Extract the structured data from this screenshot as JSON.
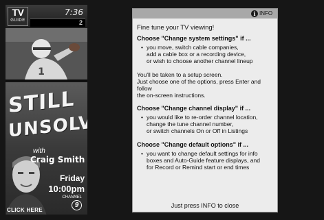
{
  "header": {
    "logo_top": "TV",
    "logo_bottom": "GUIDE",
    "clock": "7:36",
    "channel": "2"
  },
  "ad": {
    "title_line1": "STILL",
    "title_line2": "UNSOLVED",
    "with": "with",
    "host": "Craig Smith",
    "day": "Friday",
    "time": "10:00pm",
    "channel_word": "CHANNEL",
    "channel_num": "9",
    "cta": "CLICK HERE"
  },
  "info": {
    "header_icon": "i",
    "header_label": "INFO",
    "intro": "Fine tune your TV viewing!",
    "sections": [
      {
        "heading": "Choose \"Change system settings\" if ...",
        "bullet": "you move, switch cable companies,\nadd a cable box or a recording device,\nor wish to choose another channel lineup"
      },
      {
        "heading": "Choose \"Change channel display\" if ...",
        "bullet": "you would like to re-order channel location,\nchange the tune channel number,\nor switch channels On or Off in Listings"
      },
      {
        "heading": "Choose \"Change default options\" if ...",
        "bullet": "you want to change default settings for info\nboxes and Auto-Guide feature displays, and\nfor Record or Remind start or end times"
      }
    ],
    "setup_note": "You'll be taken to a setup screen.\nJust choose one of the options, press Enter and follow\nthe on-screen instructions.",
    "close_hint": "Just press INFO to close"
  },
  "colors": {
    "panel_bg": "#ececec",
    "panel_header": "#a8a8a8",
    "screen_bg": "#161616"
  }
}
